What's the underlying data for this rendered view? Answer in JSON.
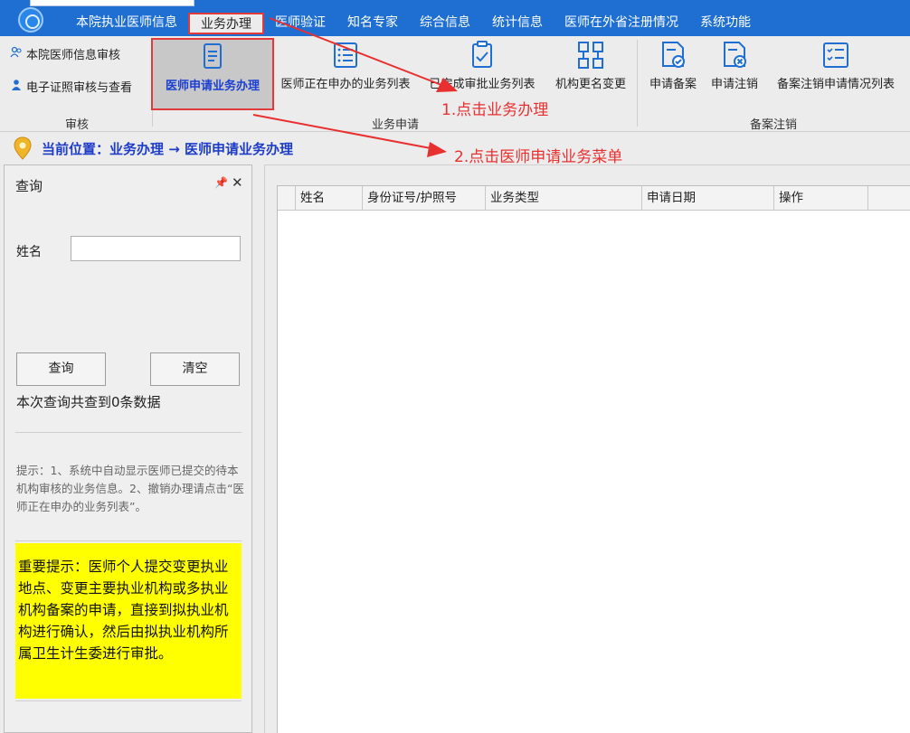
{
  "menu": {
    "items": [
      "本院执业医师信息",
      "业务办理",
      "医师验证",
      "知名专家",
      "综合信息",
      "统计信息",
      "医师在外省注册情况",
      "系统功能"
    ],
    "active_index": 1
  },
  "ribbon": {
    "audit": {
      "group_label": "审核",
      "buttons": [
        "本院医师信息审核",
        "电子证照审核与查看"
      ]
    },
    "business": {
      "group_label": "业务申请",
      "buttons": [
        "医师申请业务办理",
        "医师正在申办的业务列表",
        "已完成审批业务列表",
        "机构更名变更"
      ]
    },
    "filing": {
      "group_label": "备案注销",
      "buttons": [
        "申请备案",
        "申请注销",
        "备案注销申请情况列表"
      ]
    }
  },
  "breadcrumb": {
    "text": "当前位置：业务办理 → 医师申请业务办理"
  },
  "annotations": {
    "step1": "1.点击业务办理",
    "step2": "2.点击医师申请业务菜单",
    "color": "#e83030"
  },
  "query_panel": {
    "title": "查询",
    "pin_icon": "pin-icon",
    "close_icon": "close-icon",
    "name_label": "姓名",
    "name_value": "",
    "search_button": "查询",
    "clear_button": "清空",
    "result_count": "本次查询共查到0条数据",
    "tip": "提示：1、系统中自动显示医师已提交的待本机构审核的业务信息。2、撤销办理请点击“医师正在申办的业务列表”。",
    "important": "重要提示：医师个人提交变更执业地点、变更主要执业机构或多执业机构备案的申请，直接到拟执业机构进行确认，然后由拟执业机构所属卫生计生委进行审批。"
  },
  "grid": {
    "columns": [
      "",
      "姓名",
      "身份证号/护照号",
      "业务类型",
      "申请日期",
      "操作",
      ""
    ],
    "rows": []
  },
  "colors": {
    "title_bar": "#1e6fd1",
    "highlight_border": "#e03a3a",
    "breadcrumb_text": "#1e3cc8",
    "important_bg": "#ffff00"
  }
}
